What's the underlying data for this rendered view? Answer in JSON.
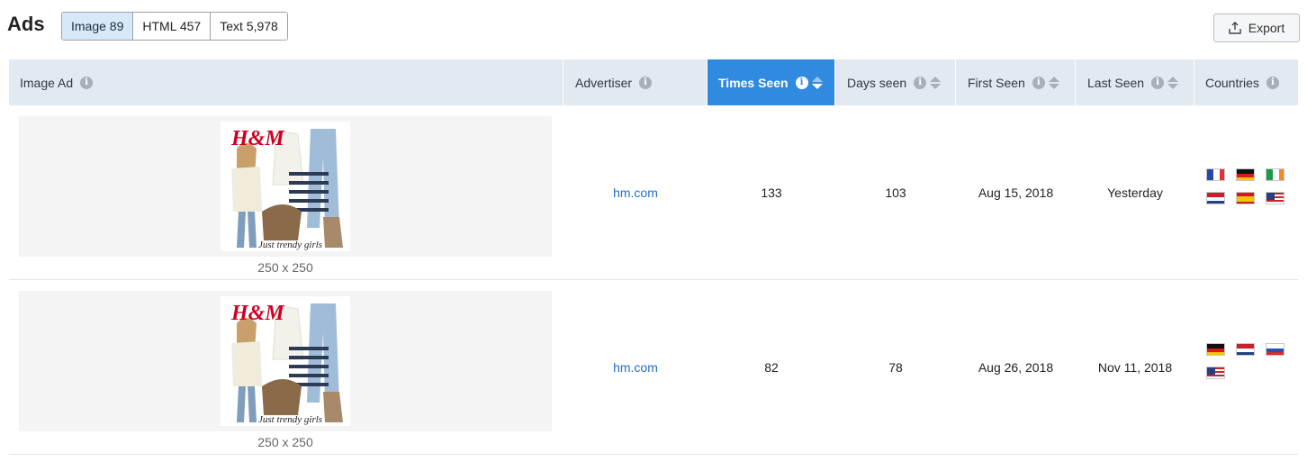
{
  "page": {
    "title": "Ads"
  },
  "tabs": [
    {
      "label": "Image 89",
      "active": true
    },
    {
      "label": "HTML 457",
      "active": false
    },
    {
      "label": "Text 5,978",
      "active": false
    }
  ],
  "toolbar": {
    "export_label": "Export",
    "export_icon": "upload-icon"
  },
  "table": {
    "columns": [
      {
        "key": "image_ad",
        "label": "Image Ad",
        "info": true,
        "sortable": false,
        "sorted": false
      },
      {
        "key": "advertiser",
        "label": "Advertiser",
        "info": true,
        "sortable": false,
        "sorted": false
      },
      {
        "key": "times_seen",
        "label": "Times Seen",
        "info": true,
        "sortable": true,
        "sorted": true
      },
      {
        "key": "days_seen",
        "label": "Days seen",
        "info": true,
        "sortable": true,
        "sorted": false
      },
      {
        "key": "first_seen",
        "label": "First Seen",
        "info": true,
        "sortable": true,
        "sorted": false
      },
      {
        "key": "last_seen",
        "label": "Last Seen",
        "info": true,
        "sortable": true,
        "sorted": false
      },
      {
        "key": "countries",
        "label": "Countries",
        "info": true,
        "sortable": false,
        "sorted": false
      }
    ],
    "rows": [
      {
        "ad_size": "250 x 250",
        "ad_brand": "H&M",
        "ad_caption": "Just trendy girls",
        "advertiser": "hm.com",
        "times_seen": "133",
        "days_seen": "103",
        "first_seen": "Aug 15, 2018",
        "last_seen": "Yesterday",
        "countries": [
          "fr",
          "de",
          "ie",
          "nl",
          "es",
          "us"
        ]
      },
      {
        "ad_size": "250 x 250",
        "ad_brand": "H&M",
        "ad_caption": "Just trendy girls",
        "advertiser": "hm.com",
        "times_seen": "82",
        "days_seen": "78",
        "first_seen": "Aug 26, 2018",
        "last_seen": "Nov 11, 2018",
        "countries": [
          "de",
          "nl",
          "ru",
          "us"
        ]
      }
    ]
  },
  "colors": {
    "accent": "#2f8ae0",
    "header_bg": "#e1e9f1",
    "link": "#1e6fc4",
    "active_tab": "#d7e9f8"
  }
}
